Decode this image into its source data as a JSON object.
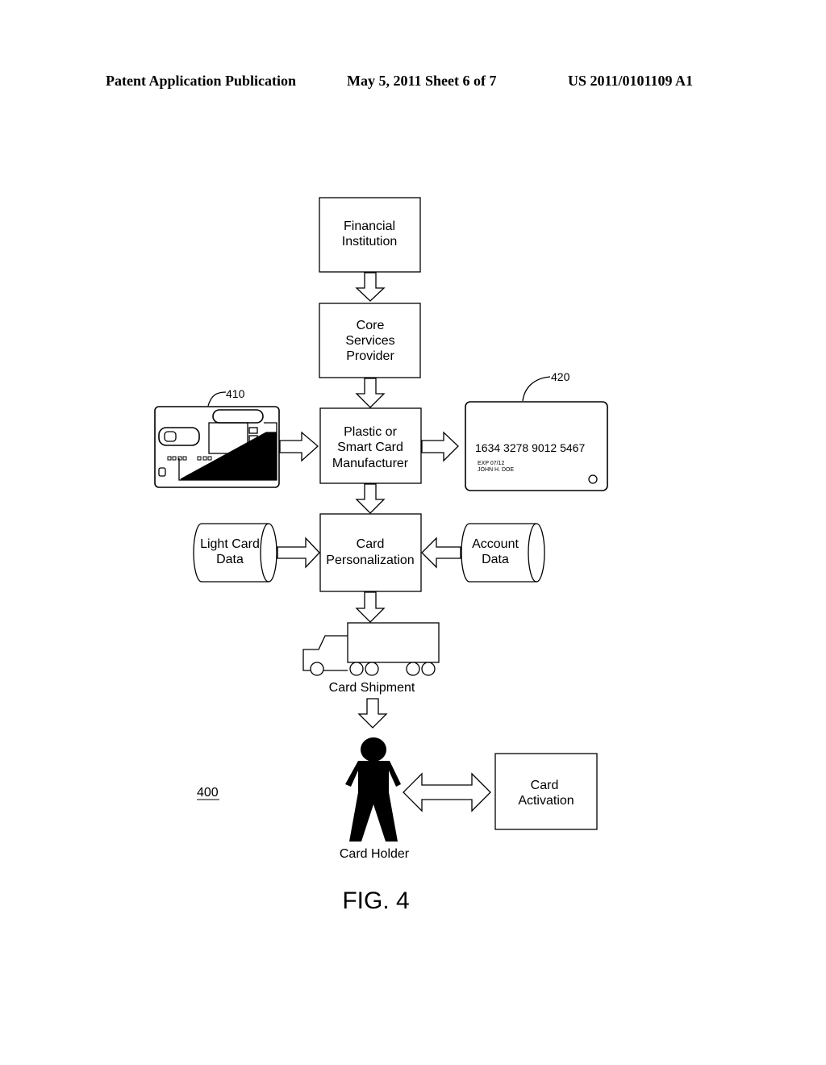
{
  "header": {
    "publication": "Patent Application Publication",
    "date_sheet": "May 5, 2011   Sheet 6 of 7",
    "number": "US 2011/0101109 A1"
  },
  "nodes": {
    "financial_institution": [
      "Financial",
      "Institution"
    ],
    "core_services": [
      "Core",
      "Services",
      "Provider"
    ],
    "manufacturer": [
      "Plastic or",
      "Smart Card",
      "Manufacturer"
    ],
    "personalization": [
      "Card",
      "Personalization"
    ],
    "light_card_data": [
      "Light Card",
      "Data"
    ],
    "account_data": [
      "Account",
      "Data"
    ],
    "card_shipment": "Card Shipment",
    "card_holder": "Card Holder",
    "card_activation": [
      "Card",
      "Activation"
    ]
  },
  "card_420": {
    "number": "1634  3278  9012  5467",
    "expiry": "EXP 07/12",
    "name": "JOHN H. DOE"
  },
  "refs": {
    "smart_card": "410",
    "plastic_card": "420",
    "figure_ref": "400"
  },
  "figure_label": "FIG. 4"
}
